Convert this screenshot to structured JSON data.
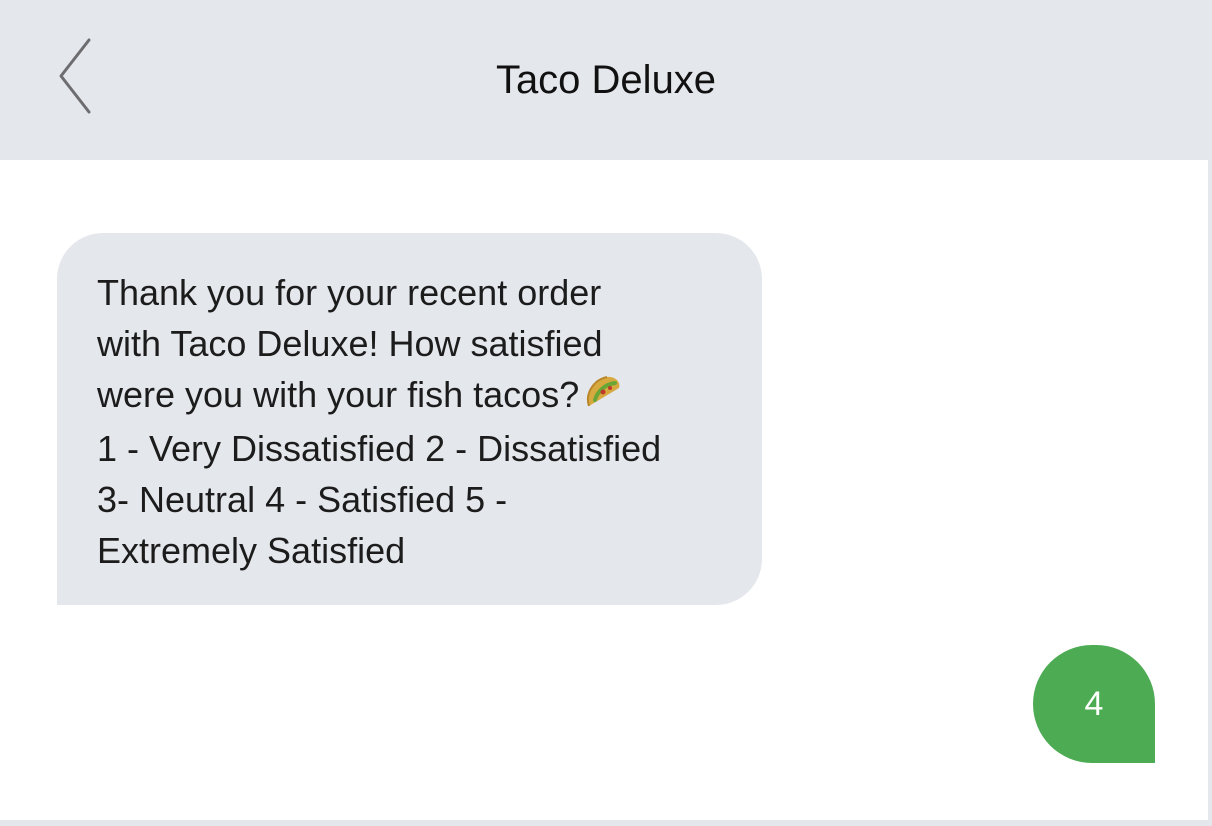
{
  "header": {
    "back_icon": "chevron-left-icon",
    "title": "Taco Deluxe"
  },
  "messages": {
    "incoming": {
      "lines": [
        "Thank you for your recent order",
        "with Taco Deluxe! How satisfied",
        "were you with your fish tacos?",
        "1 - Very Dissatisfied 2 - Dissatisfied",
        "3- Neutral 4 - Satisfied 5 -",
        "Extremely Satisfied"
      ],
      "emoji": "taco-icon"
    },
    "outgoing": {
      "text": "4"
    }
  },
  "colors": {
    "header_bg": "#e4e7ec",
    "incoming_bubble": "#e4e7ec",
    "outgoing_bubble": "#4cab53"
  }
}
